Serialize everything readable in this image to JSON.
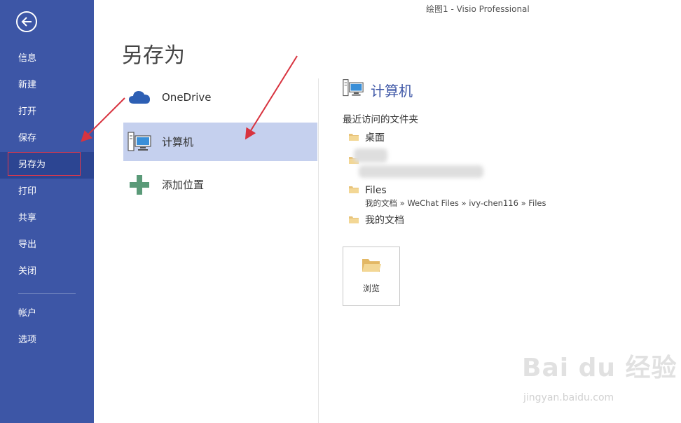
{
  "window": {
    "title": "绘图1 - Visio Professional"
  },
  "sidebar": {
    "items": [
      {
        "label": "信息"
      },
      {
        "label": "新建"
      },
      {
        "label": "打开"
      },
      {
        "label": "保存"
      },
      {
        "label": "另存为",
        "selected": true
      },
      {
        "label": "打印"
      },
      {
        "label": "共享"
      },
      {
        "label": "导出"
      },
      {
        "label": "关闭"
      },
      {
        "label": "帐户"
      },
      {
        "label": "选项"
      }
    ],
    "colors": {
      "background": "#3d56a6",
      "selected": "#2c4592",
      "highlight_border": "#e0384a"
    }
  },
  "main": {
    "title": "另存为",
    "locations": [
      {
        "label": "OneDrive",
        "icon": "cloud-icon"
      },
      {
        "label": "计算机",
        "icon": "computer-icon",
        "selected": true
      },
      {
        "label": "添加位置",
        "icon": "plus-icon"
      }
    ]
  },
  "panel": {
    "heading": "计算机",
    "recent_label": "最近访问的文件夹",
    "folders": [
      {
        "name": "桌面"
      },
      {
        "name": "Files",
        "path": "我的文档 » WeChat Files » ivy-chen116 » Files"
      },
      {
        "name": "我的文档"
      }
    ],
    "browse_label": "浏览"
  },
  "watermark": {
    "text": "Bai du 经验",
    "sub": "jingyan.baidu.com"
  }
}
